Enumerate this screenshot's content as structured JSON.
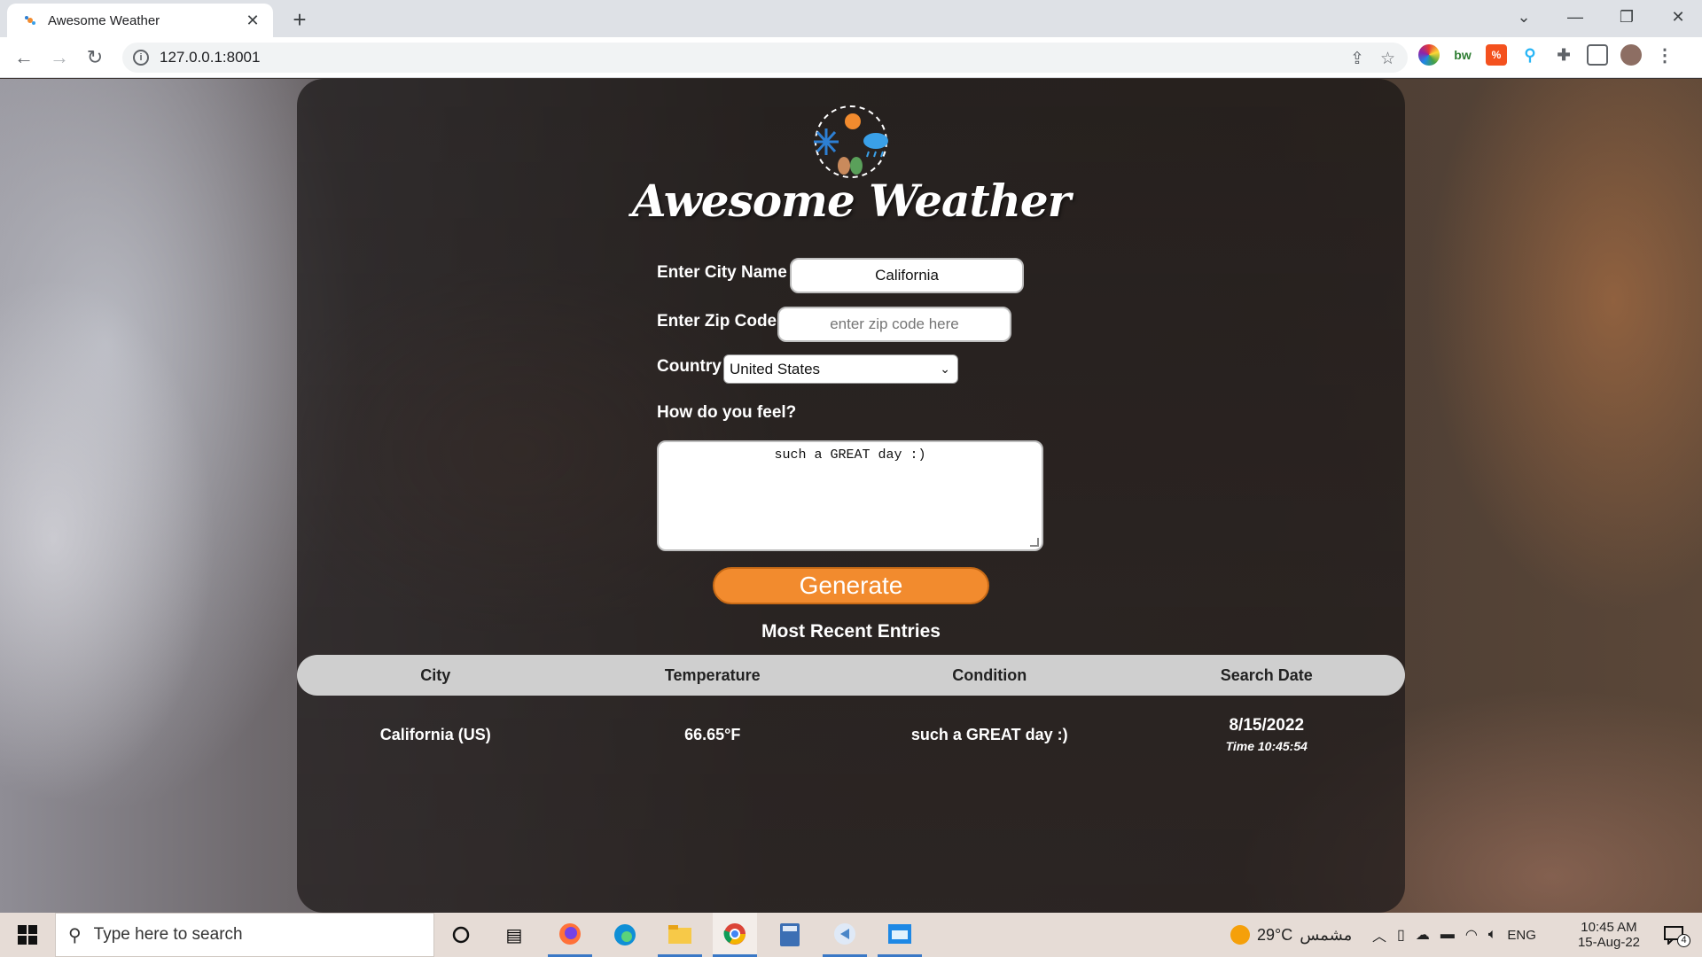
{
  "browser": {
    "tab_title": "Awesome Weather",
    "tab_close": "✕",
    "new_tab": "+",
    "url": "127.0.0.1:8001",
    "win_min": "—",
    "win_restore": "❐",
    "win_close": "✕",
    "tab_search": "⌄"
  },
  "app": {
    "title": "Awesome Weather",
    "city_label": "Enter City Name",
    "city_value": "California",
    "zip_label": "Enter Zip Code",
    "zip_placeholder": "enter zip code here",
    "country_label": "Country",
    "country_value": "United States",
    "feel_label": "How do you feel?",
    "feel_value": "such a GREAT day :)",
    "generate_label": "Generate",
    "recent_heading": "Most Recent Entries",
    "table": {
      "headers": [
        "City",
        "Temperature",
        "Condition",
        "Search Date"
      ],
      "rows": [
        {
          "city": "California (US)",
          "temperature": "66.65°F",
          "condition": "such a GREAT day :)",
          "date": "8/15/2022",
          "time": "Time 10:45:54"
        }
      ]
    }
  },
  "taskbar": {
    "search_placeholder": "Type here to search",
    "weather_temp": "29°C",
    "weather_text": "مشمس",
    "language": "ENG",
    "time": "10:45 AM",
    "date": "15-Aug-22",
    "notification_count": "4"
  }
}
